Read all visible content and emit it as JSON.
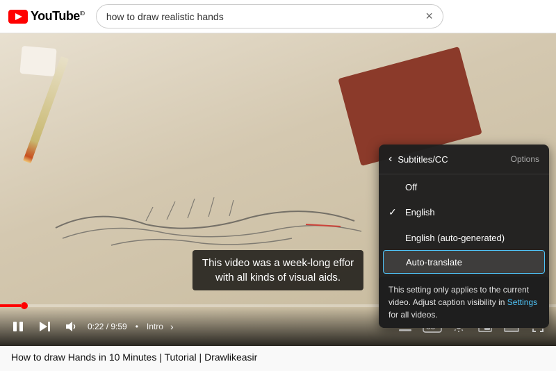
{
  "header": {
    "logo_text": "YouTube",
    "logo_super": "ID",
    "search_value": "how to draw realistic hands",
    "close_label": "×"
  },
  "video": {
    "subtitle_line1": "This video was a week-long effor",
    "subtitle_line2": "with all kinds of visual aids.",
    "progress_time": "0:22 / 9:59",
    "chapter": "Intro",
    "chapter_arrow": "›"
  },
  "controls": {
    "play_icon": "▐▐",
    "skip_icon": "⏭",
    "volume_icon": "🔊",
    "miniplayer_icon": "⧉",
    "theater_icon": "▬",
    "fullscreen_icon": "⛶",
    "settings_icon": "⚙",
    "captions_icon": "CC",
    "chapters_icon": "≡"
  },
  "captions_panel": {
    "back_icon": "‹",
    "title": "Subtitles/CC",
    "options_label": "Options",
    "items": [
      {
        "id": "off",
        "label": "Off",
        "selected": false
      },
      {
        "id": "english",
        "label": "English",
        "selected": true
      },
      {
        "id": "english-auto",
        "label": "English (auto-generated)",
        "selected": false
      },
      {
        "id": "auto-translate",
        "label": "Auto-translate",
        "selected": false,
        "active": true
      }
    ],
    "tooltip": "This setting only applies to the current video. Adjust caption visibility in",
    "tooltip_link": "Settings",
    "tooltip_suffix": "for all videos."
  },
  "page_title": "How to draw Hands in 10 Minutes | Tutorial | Drawlikeasir"
}
